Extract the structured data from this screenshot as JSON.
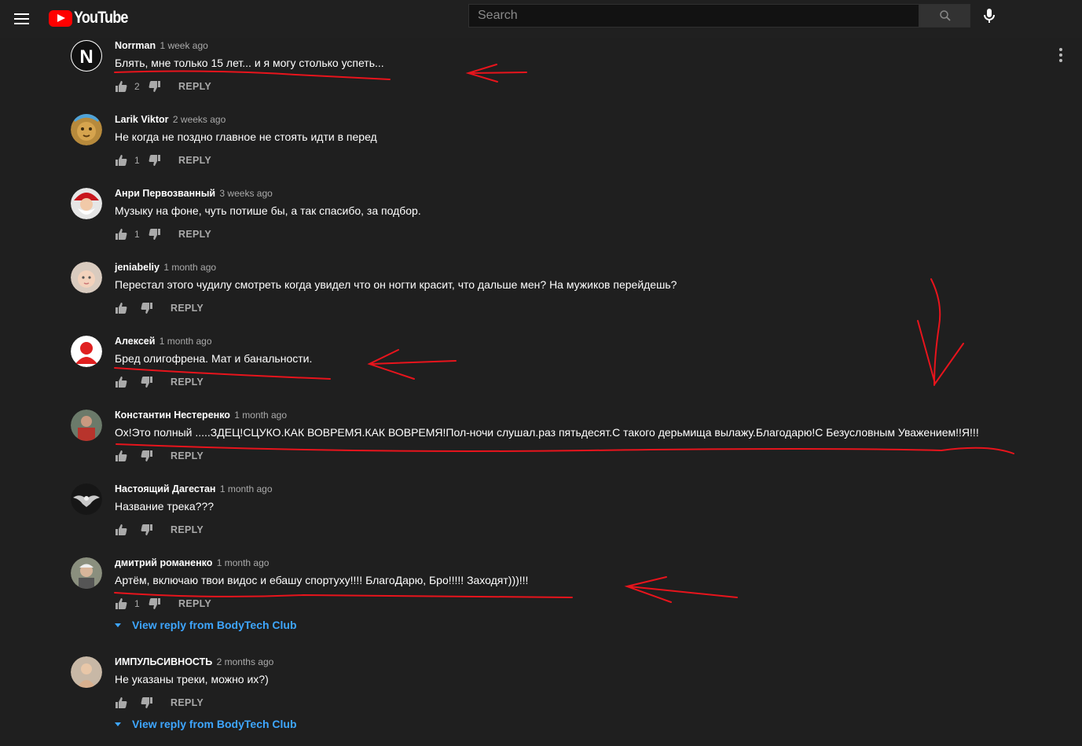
{
  "header": {
    "logo_text": "YouTube",
    "search_placeholder": "Search",
    "menu_icon": "hamburger-menu-icon",
    "search_icon": "search-icon",
    "mic_icon": "microphone-icon"
  },
  "colors": {
    "background": "#1f1f1f",
    "masthead": "#202020",
    "link_blue": "#3ea6ff",
    "annotation_red": "#e8141c",
    "youtube_red": "#ff0000"
  },
  "comments": [
    {
      "author": "Norrman",
      "time": "1 week ago",
      "text": "Блять, мне только 15 лет... и я могу столько успеть...",
      "likes": "2",
      "reply": "REPLY"
    },
    {
      "author": "Larik Viktor",
      "time": "2 weeks ago",
      "text": "Не когда не поздно главное не стоять идти в перед",
      "likes": "1",
      "reply": "REPLY"
    },
    {
      "author": "Анри Первозванный",
      "time": "3 weeks ago",
      "text": "Музыку на фоне, чуть потише бы, а так спасибо, за подбор.",
      "likes": "1",
      "reply": "REPLY"
    },
    {
      "author": "jeniabeliy",
      "time": "1 month ago",
      "text": "Перестал этого чудилу смотреть когда увидел что он ногти красит, что дальше мен? На мужиков перейдешь?",
      "likes": "",
      "reply": "REPLY"
    },
    {
      "author": "Алексей",
      "time": "1 month ago",
      "text": "Бред олигофрена. Мат и банальности.",
      "likes": "",
      "reply": "REPLY"
    },
    {
      "author": "Константин Нестеренко",
      "time": "1 month ago",
      "text": "Ох!Это полный .....ЗДЕЦ!СЦУКО.КАК ВОВРЕМЯ.КАК ВОВРЕМЯ!Пол-ночи слушал.раз пятьдесят.С такого дерьмища вылажу.Благодарю!С Безусловным Уважением!!Я!!!",
      "likes": "",
      "reply": "REPLY"
    },
    {
      "author": "Настоящий Дагестан",
      "time": "1 month ago",
      "text": "Название трека???",
      "likes": "",
      "reply": "REPLY"
    },
    {
      "author": "дмитрий романенко",
      "time": "1 month ago",
      "text": "Артём, включаю твои видос и ебашу спортуху!!!! БлагоДарю, Бро!!!!! Заходят)))!!!",
      "likes": "1",
      "reply": "REPLY",
      "view_reply": "View reply from BodyTech Club"
    },
    {
      "author": "ИМПУЛЬСИВНОСТЬ",
      "time": "2 months ago",
      "text": "Не указаны треки, можно их?)",
      "likes": "",
      "reply": "REPLY",
      "view_reply": "View reply from BodyTech Club"
    }
  ]
}
